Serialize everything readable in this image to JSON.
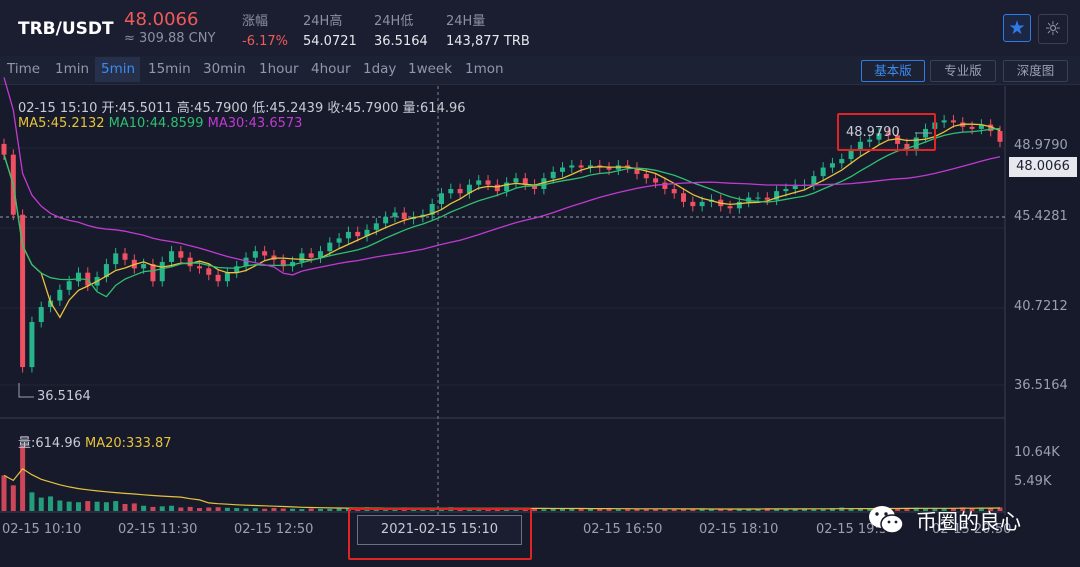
{
  "header": {
    "pair": "TRB/USDT",
    "last_price": "48.0066",
    "cny_price": "≈ 309.88 CNY",
    "stats": [
      {
        "label": "涨幅",
        "value": "-6.17%",
        "negative": true
      },
      {
        "label": "24H高",
        "value": "54.0721",
        "negative": false
      },
      {
        "label": "24H低",
        "value": "36.5164",
        "negative": false
      },
      {
        "label": "24H量",
        "value": "143,877 TRB",
        "negative": false
      }
    ],
    "favorite_icon": "star-icon",
    "theme_icon": "sun-icon"
  },
  "toolbar": {
    "timeframes": [
      "Time",
      "1min",
      "5min",
      "15min",
      "30min",
      "1hour",
      "4hour",
      "1day",
      "1week",
      "1mon"
    ],
    "active_timeframe": "5min",
    "modes": [
      "基本版",
      "专业版",
      "深度图"
    ],
    "active_mode": "基本版"
  },
  "ohlc_line": {
    "time": "02-15 15:10",
    "open": "开:45.5011",
    "high": "高:45.7900",
    "low": "低:45.2439",
    "close": "收:45.7900",
    "volume": "量:614.96"
  },
  "ma_line": {
    "ma5": "MA5:45.2132",
    "ma10": "MA10:44.8599",
    "ma30": "MA30:43.6573"
  },
  "volume_line": {
    "volume": "量:614.96",
    "ma20": "MA20:333.87"
  },
  "price_axis": {
    "ticks": [
      "48.9790",
      "45.4281",
      "40.7212",
      "36.5164"
    ],
    "current_price": "48.0066",
    "max_marker": "48.9790",
    "min_marker": "36.5164"
  },
  "volume_axis": {
    "ticks": [
      "10.64K",
      "5.49K"
    ]
  },
  "time_axis": {
    "ticks": [
      "02-15 10:10",
      "02-15 11:30",
      "02-15 12:50",
      "02-15 16:50",
      "02-15 18:10",
      "02-15 19:30",
      "02-15 20:50"
    ],
    "crosshair_label": "2021-02-15 15:10"
  },
  "colors": {
    "up": "#26b58a",
    "down": "#ef5062",
    "ma5": "#e8c33a",
    "ma10": "#2fbf71",
    "ma30": "#c13ad0",
    "accent": "#2f7be5",
    "highlight": "#e02424"
  },
  "watermark": {
    "text": "币圈的良心",
    "icon": "wechat-icon"
  },
  "chart_data": {
    "type": "candlestick",
    "ylim": [
      35.5,
      50.6
    ],
    "close": [
      47.4,
      44.6,
      37.5,
      39.6,
      40.3,
      40.6,
      41.1,
      41.5,
      41.9,
      41.3,
      41.7,
      42.3,
      42.8,
      42.5,
      42.1,
      42.3,
      41.5,
      42.4,
      42.9,
      42.6,
      42.2,
      42.1,
      41.8,
      41.5,
      41.9,
      42.2,
      42.6,
      42.9,
      42.7,
      42.5,
      42.2,
      42.4,
      42.8,
      42.6,
      42.9,
      43.3,
      43.5,
      43.8,
      43.6,
      43.9,
      44.2,
      44.5,
      44.7,
      44.4,
      44.5,
      44.6,
      45.1,
      45.6,
      45.8,
      45.6,
      46.0,
      46.2,
      46.0,
      45.7,
      46.1,
      46.3,
      46.0,
      45.8,
      46.3,
      46.6,
      46.8,
      46.9,
      46.8,
      46.9,
      46.8,
      46.7,
      46.9,
      46.8,
      46.5,
      46.3,
      46.1,
      45.8,
      45.6,
      45.2,
      45.0,
      45.2,
      45.3,
      45.0,
      44.9,
      45.2,
      45.4,
      45.4,
      45.3,
      45.7,
      45.8,
      46.0,
      46.0,
      46.4,
      46.8,
      47.0,
      47.2,
      47.6,
      48.0,
      48.1,
      48.4,
      48.3,
      47.9,
      47.6,
      48.2,
      48.6,
      48.9,
      49.0,
      48.9,
      48.7,
      48.6,
      48.8,
      48.5,
      48.0
    ],
    "volume": [
      6100,
      4400,
      11200,
      3200,
      2300,
      2500,
      1800,
      1600,
      1500,
      1700,
      1600,
      1500,
      1700,
      1200,
      1300,
      900,
      700,
      800,
      900,
      600,
      700,
      500,
      600,
      650,
      550,
      500,
      420,
      480,
      380,
      520,
      430,
      390,
      330,
      420,
      380,
      360,
      520,
      470,
      400,
      620,
      520,
      380,
      430,
      550,
      480,
      370,
      420,
      500,
      610,
      390,
      360,
      480,
      420,
      460,
      390,
      350,
      420,
      380,
      320,
      400,
      410,
      380,
      360,
      340,
      330,
      370,
      320,
      330,
      360,
      380,
      400,
      350,
      330,
      310,
      290,
      320,
      300,
      360,
      340,
      380,
      420,
      400,
      450,
      380,
      360,
      410,
      460,
      430,
      380,
      500,
      600,
      520,
      480,
      440,
      520,
      470,
      430,
      480,
      560,
      510,
      480,
      440,
      460,
      620,
      510,
      540,
      580,
      615
    ],
    "ma5_last": 45.2132,
    "ma10_last": 44.8599,
    "ma30_last": 43.6573,
    "volume_ma20_last": 333.87
  }
}
